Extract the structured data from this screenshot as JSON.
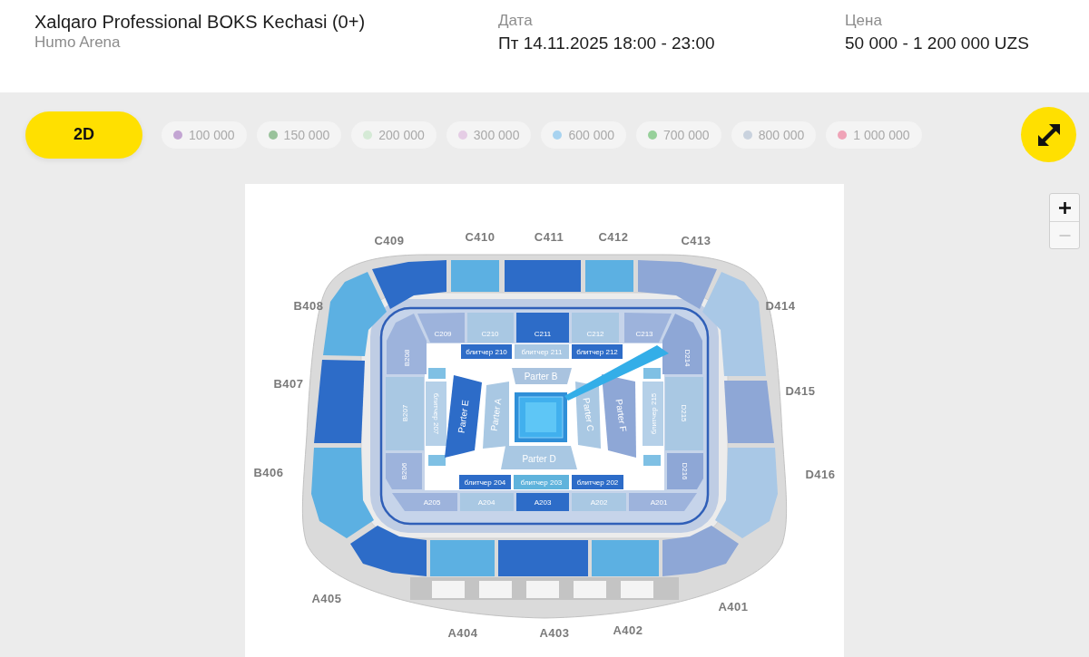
{
  "event": {
    "title": "Xalqaro Professional BOKS Kechasi (0+)",
    "venue": "Humo Arena"
  },
  "info": [
    {
      "label": "Дата",
      "value": "Пт 14.11.2025 18:00 - 23:00"
    },
    {
      "label": "Цена",
      "value": "50 000 - 1 200 000 UZS"
    }
  ],
  "view_button": {
    "label": "2D"
  },
  "price_legend": [
    {
      "label": "100 000",
      "color": "#c3a5d3"
    },
    {
      "label": "150 000",
      "color": "#99c29b"
    },
    {
      "label": "200 000",
      "color": "#d5ead6"
    },
    {
      "label": "300 000",
      "color": "#e5cde5"
    },
    {
      "label": "600 000",
      "color": "#a8d3f0"
    },
    {
      "label": "700 000",
      "color": "#97d09a"
    },
    {
      "label": "800 000",
      "color": "#c9d2de"
    },
    {
      "label": "1 000 000",
      "color": "#efa3b7"
    }
  ],
  "zoom_controls": [
    {
      "kind": "zoom_in",
      "disabled": false
    },
    {
      "kind": "zoom_out",
      "disabled": true
    }
  ],
  "seat_map": {
    "upper_sections": [
      {
        "label": "C409",
        "color": "#2d6cc8"
      },
      {
        "label": "C410",
        "color": "#5cb0e2"
      },
      {
        "label": "C411",
        "color": "#2d6cc8"
      },
      {
        "label": "C412",
        "color": "#5cb0e2"
      },
      {
        "label": "C413",
        "color": "#8ea7d6"
      },
      {
        "label": "B408",
        "color": "#5cb0e2"
      },
      {
        "label": "D414",
        "color": "#a9c8e6"
      },
      {
        "label": "B407",
        "color": "#2d6cc8"
      },
      {
        "label": "D415",
        "color": "#8ea7d6"
      },
      {
        "label": "B406",
        "color": "#5cb0e2"
      },
      {
        "label": "D416",
        "color": "#a9c8e6"
      },
      {
        "label": "A405",
        "color": "#2d6cc8"
      },
      {
        "label": "A401",
        "color": "#8ea7d6"
      },
      {
        "label": "A404",
        "color": "#5cb0e2"
      },
      {
        "label": "A403",
        "color": "#2d6cc8"
      },
      {
        "label": "A402",
        "color": "#5cb0e2"
      }
    ],
    "lower_sections": [
      {
        "label": "C209",
        "color": "#9db3dc"
      },
      {
        "label": "C210",
        "color": "#a9c8e3"
      },
      {
        "label": "C211",
        "color": "#2d6cc8"
      },
      {
        "label": "C212",
        "color": "#a9c8e3"
      },
      {
        "label": "C213",
        "color": "#9db3dc"
      },
      {
        "label": "B208",
        "color": "#9db3dc"
      },
      {
        "label": "D214",
        "color": "#8ea7d6"
      },
      {
        "label": "B207",
        "color": "#a9c8e3"
      },
      {
        "label": "D215",
        "color": "#a9c8e3"
      },
      {
        "label": "B206",
        "color": "#9db3dc"
      },
      {
        "label": "D216",
        "color": "#8ea7d6"
      },
      {
        "label": "A205",
        "color": "#9db3dc"
      },
      {
        "label": "A204",
        "color": "#a9c8e3"
      },
      {
        "label": "A203",
        "color": "#2d6cc8"
      },
      {
        "label": "A202",
        "color": "#a9c8e3"
      },
      {
        "label": "A201",
        "color": "#9db3dc"
      }
    ],
    "bleachers": [
      {
        "label": "блитчер 210",
        "color": "#2d6cc8"
      },
      {
        "label": "блитчер 211",
        "color": "#a9c8e3"
      },
      {
        "label": "блитчер 212",
        "color": "#2d6cc8"
      },
      {
        "label": "блитчер 207",
        "color": "#b5d0e8"
      },
      {
        "label": "блитчер 215",
        "color": "#b5d0e8"
      },
      {
        "label": "блитчер 204",
        "color": "#2d6cc8"
      },
      {
        "label": "блитчер 203",
        "color": "#5fb3dc"
      },
      {
        "label": "блитчер 202",
        "color": "#2d6cc8"
      }
    ],
    "parterre": [
      {
        "label": "Parter B",
        "color": "#a9c3df"
      },
      {
        "label": "Parter E",
        "color": "#2d6cc8"
      },
      {
        "label": "Parter A",
        "color": "#a9c8e3"
      },
      {
        "label": "Parter C",
        "color": "#a9c8e3"
      },
      {
        "label": "Parter F",
        "color": "#8ea7d6"
      },
      {
        "label": "Parter D",
        "color": "#a9c8e3"
      }
    ]
  }
}
